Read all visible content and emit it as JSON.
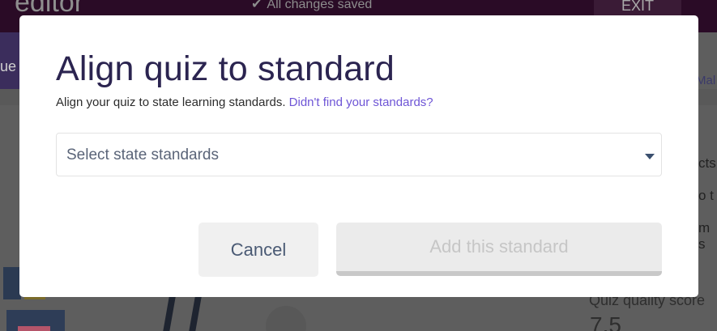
{
  "background": {
    "app_title": "editor",
    "saved_status": "All changes saved",
    "exit_label": "EXIT",
    "left_tab_fragment": "ue",
    "right_fragments": [
      "Mal",
      "cts",
      "o t",
      "m s"
    ],
    "quality_label": "Quiz quality score",
    "quality_value": "7.5"
  },
  "modal": {
    "title": "Align quiz to standard",
    "subtitle": "Align your quiz to state learning standards.",
    "subtitle_link": "Didn't find your standards?",
    "select": {
      "placeholder": "Select state standards",
      "caret_icon": "caret-down-icon"
    },
    "cancel_label": "Cancel",
    "add_label": "Add this standard"
  },
  "colors": {
    "title": "#2b2450",
    "link": "#6e55d6",
    "overlay_bg": "#5e5e5e",
    "topbar": "#2a0b26"
  }
}
